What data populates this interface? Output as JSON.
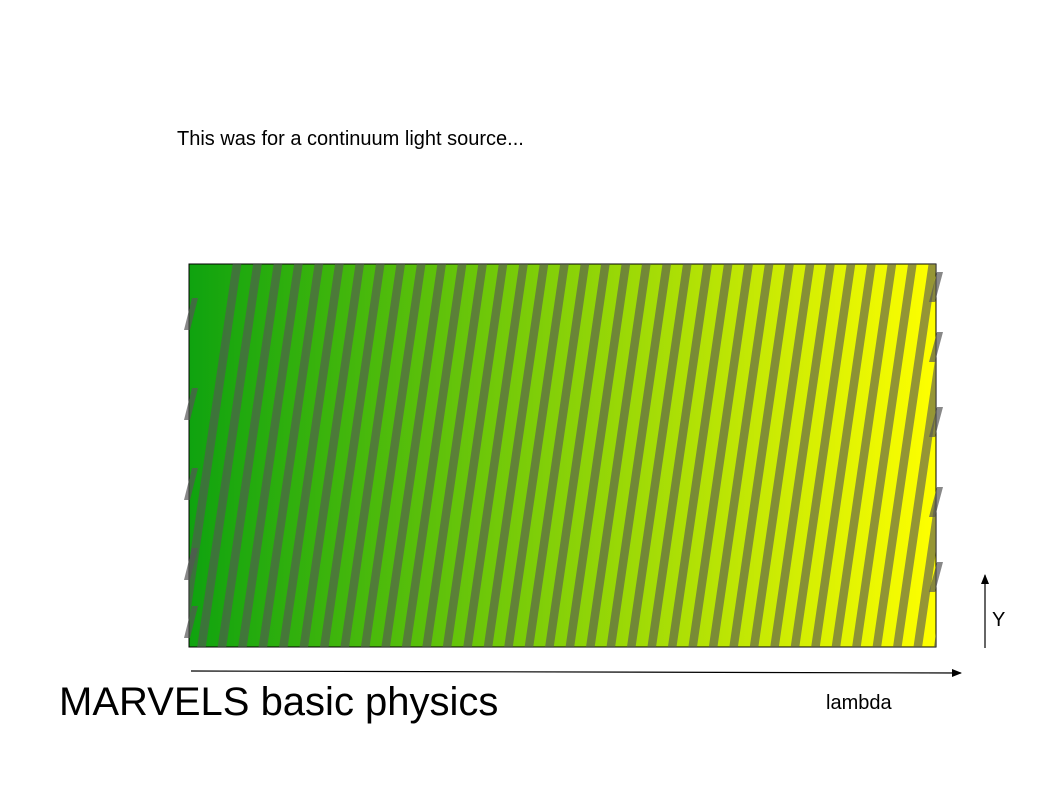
{
  "note_text": "This was for a continuum light source...",
  "slide_title": "MARVELS basic physics",
  "axis": {
    "x_label": "lambda",
    "y_label": "Y"
  },
  "colors": {
    "gradient_start": "#0fa30f",
    "gradient_end": "#ffff00",
    "fringe": "#555555",
    "axis": "#000000"
  },
  "fringe_count": 37
}
